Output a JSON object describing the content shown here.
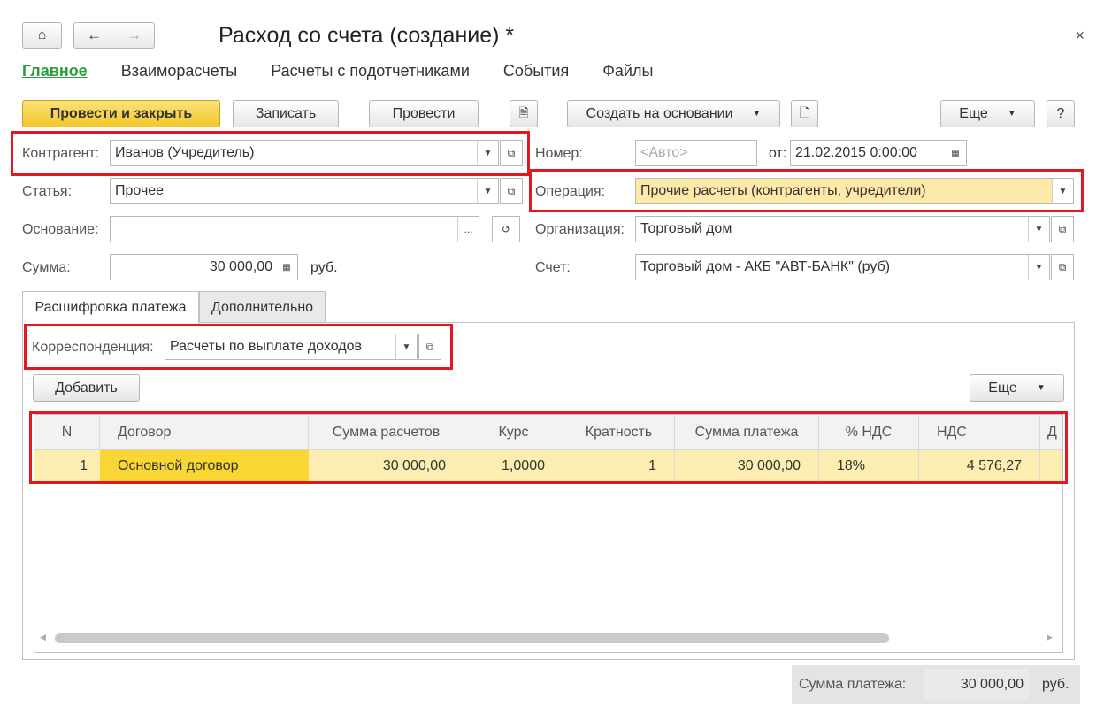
{
  "window": {
    "title": "Расход со счета (создание) *",
    "close_glyph": "×"
  },
  "nav": {
    "home_glyph": "🏠",
    "back_glyph": "🡐",
    "forward_glyph": "🡒"
  },
  "tabs": [
    {
      "label": "Главное",
      "active": true
    },
    {
      "label": "Взаиморасчеты"
    },
    {
      "label": "Расчеты с подотчетниками"
    },
    {
      "label": "События"
    },
    {
      "label": "Файлы"
    }
  ],
  "toolbar": {
    "post_close": "Провести и закрыть",
    "save": "Записать",
    "post": "Провести",
    "create_based": "Создать на основании",
    "more": "Еще",
    "help": "?"
  },
  "form": {
    "counterparty_label": "Контрагент:",
    "counterparty_value": "Иванов (Учредитель)",
    "article_label": "Статья:",
    "article_value": "Прочее",
    "basis_label": "Основание:",
    "basis_value": "",
    "basis_ellipsis": "...",
    "amount_label": "Сумма:",
    "amount_value": "30 000,00",
    "amount_currency": "руб.",
    "number_label": "Номер:",
    "number_placeholder": "<Авто>",
    "date_label": "от:",
    "date_value": "21.02.2015  0:00:00",
    "operation_label": "Операция:",
    "operation_value": "Прочие расчеты (контрагенты, учредители)",
    "org_label": "Организация:",
    "org_value": "Торговый дом",
    "account_label": "Счет:",
    "account_value": "Торговый дом - АКБ \"АВТ-БАНК\" (руб)"
  },
  "inner_tabs": [
    {
      "label": "Расшифровка платежа",
      "active": true
    },
    {
      "label": "Дополнительно"
    }
  ],
  "payment": {
    "corr_label": "Корреспонденция:",
    "corr_value": "Расчеты по выплате доходов",
    "add_button": "Добавить",
    "more_button": "Еще"
  },
  "table": {
    "columns": [
      "N",
      "Договор",
      "Сумма расчетов",
      "Курс",
      "Кратность",
      "Сумма платежа",
      "% НДС",
      "НДС",
      "Д"
    ],
    "rows": [
      [
        "1",
        "Основной договор",
        "30 000,00",
        "1,0000",
        "1",
        "30 000,00",
        "18%",
        "4 576,27",
        ""
      ]
    ]
  },
  "footer": {
    "total_label": "Сумма платежа:",
    "total_value": "30 000,00",
    "total_currency": "руб."
  }
}
